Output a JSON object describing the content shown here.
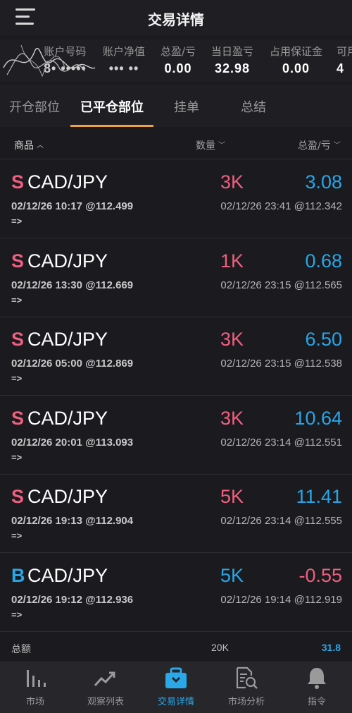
{
  "header": {
    "title": "交易详情",
    "menu_icon": "hamburger-menu-icon"
  },
  "summary": [
    {
      "label": "账户号码",
      "value": "8• •••••"
    },
    {
      "label": "账户净值",
      "value": "••• ••"
    },
    {
      "label": "总盈/亏",
      "value": "0.00"
    },
    {
      "label": "当日盈亏",
      "value": "32.98"
    },
    {
      "label": "占用保证金",
      "value": "0.00"
    },
    {
      "label": "可用",
      "value": "4"
    }
  ],
  "tabs": [
    {
      "label": "开仓部位",
      "active": false
    },
    {
      "label": "已平仓部位",
      "active": true
    },
    {
      "label": "挂单",
      "active": false
    },
    {
      "label": "总结",
      "active": false
    }
  ],
  "columns": {
    "product": "商品",
    "quantity": "数量",
    "pnl": "总盈/亏"
  },
  "colors": {
    "sell": "#ef5f7f",
    "buy": "#27a6e8",
    "profit": "#27a6e8",
    "loss": "#ef5f7f",
    "accent": "#f0a13c"
  },
  "positions": [
    {
      "side": "S",
      "symbol": "CAD/JPY",
      "qty": "3K",
      "pnl": "3.08",
      "open": "02/12/26 10:17 @112.499",
      "arrow": "=>",
      "close": "02/12/26 23:41 @112.342"
    },
    {
      "side": "S",
      "symbol": "CAD/JPY",
      "qty": "1K",
      "pnl": "0.68",
      "open": "02/12/26 13:30 @112.669",
      "arrow": "=>",
      "close": "02/12/26 23:15 @112.565"
    },
    {
      "side": "S",
      "symbol": "CAD/JPY",
      "qty": "3K",
      "pnl": "6.50",
      "open": "02/12/26 05:00 @112.869",
      "arrow": "=>",
      "close": "02/12/26 23:15 @112.538"
    },
    {
      "side": "S",
      "symbol": "CAD/JPY",
      "qty": "3K",
      "pnl": "10.64",
      "open": "02/12/26 20:01 @113.093",
      "arrow": "=>",
      "close": "02/12/26 23:14 @112.551"
    },
    {
      "side": "S",
      "symbol": "CAD/JPY",
      "qty": "5K",
      "pnl": "11.41",
      "open": "02/12/26 19:13 @112.904",
      "arrow": "=>",
      "close": "02/12/26 23:14 @112.555"
    },
    {
      "side": "B",
      "symbol": "CAD/JPY",
      "qty": "5K",
      "pnl": "-0.55",
      "open": "02/12/26 19:12 @112.936",
      "arrow": "=>",
      "close": "02/12/26 19:14 @112.919"
    }
  ],
  "totals": {
    "label": "总额",
    "qty": "20K",
    "pnl": "31.8"
  },
  "nav": [
    {
      "label": "市场",
      "icon": "market-bars-icon",
      "active": false
    },
    {
      "label": "观察列表",
      "icon": "trend-line-icon",
      "active": false
    },
    {
      "label": "交易详情",
      "icon": "briefcase-icon",
      "active": true
    },
    {
      "label": "市场分析",
      "icon": "document-search-icon",
      "active": false
    },
    {
      "label": "指令",
      "icon": "bell-icon",
      "active": false
    }
  ]
}
